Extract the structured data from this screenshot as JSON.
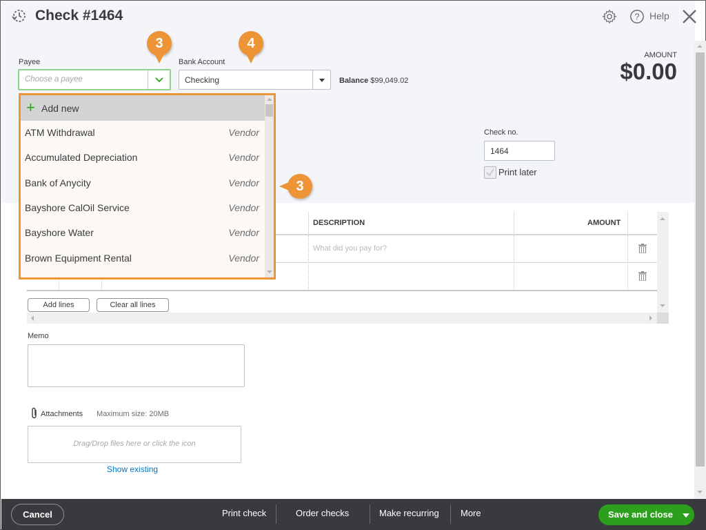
{
  "header": {
    "title": "Check #1464",
    "help_label": "Help",
    "icons": [
      "history-icon",
      "gear-icon",
      "help-icon",
      "close-icon"
    ]
  },
  "form": {
    "payee": {
      "label": "Payee",
      "placeholder": "Choose a payee"
    },
    "bank_account": {
      "label": "Bank Account",
      "value": "Checking"
    },
    "balance": {
      "label": "Balance",
      "value": "$99,049.02"
    },
    "amount": {
      "label": "AMOUNT",
      "value": "$0.00"
    },
    "check_no": {
      "label": "Check no.",
      "value": "1464"
    },
    "print_later": {
      "label": "Print later",
      "checked": true
    }
  },
  "payee_dropdown": {
    "add_new_label": "Add new",
    "items": [
      {
        "name": "ATM Withdrawal",
        "type": "Vendor"
      },
      {
        "name": "Accumulated Depreciation",
        "type": "Vendor"
      },
      {
        "name": "Bank of Anycity",
        "type": "Vendor"
      },
      {
        "name": "Bayshore CalOil Service",
        "type": "Vendor"
      },
      {
        "name": "Bayshore Water",
        "type": "Vendor"
      },
      {
        "name": "Brown Equipment Rental",
        "type": "Vendor"
      }
    ]
  },
  "callouts": {
    "payee_step": "3",
    "bank_step": "4",
    "list_step": "3"
  },
  "table": {
    "columns": {
      "description": "DESCRIPTION",
      "amount": "AMOUNT"
    },
    "description_placeholder": "What did you pay for?",
    "add_lines_label": "Add lines",
    "clear_lines_label": "Clear all lines"
  },
  "memo": {
    "label": "Memo",
    "value": ""
  },
  "attachments": {
    "label": "Attachments",
    "max_size": "Maximum size: 20MB",
    "drop_hint": "Drag/Drop files here or click the icon",
    "show_existing": "Show existing"
  },
  "footer": {
    "cancel": "Cancel",
    "print_check": "Print check",
    "order_checks": "Order checks",
    "make_recurring": "Make recurring",
    "more": "More",
    "save_and_close": "Save and close"
  },
  "colors": {
    "accent_green": "#2ca01c",
    "callout_orange": "#ed9436",
    "footer_bg": "#393a3d",
    "link_blue": "#0077c5"
  }
}
